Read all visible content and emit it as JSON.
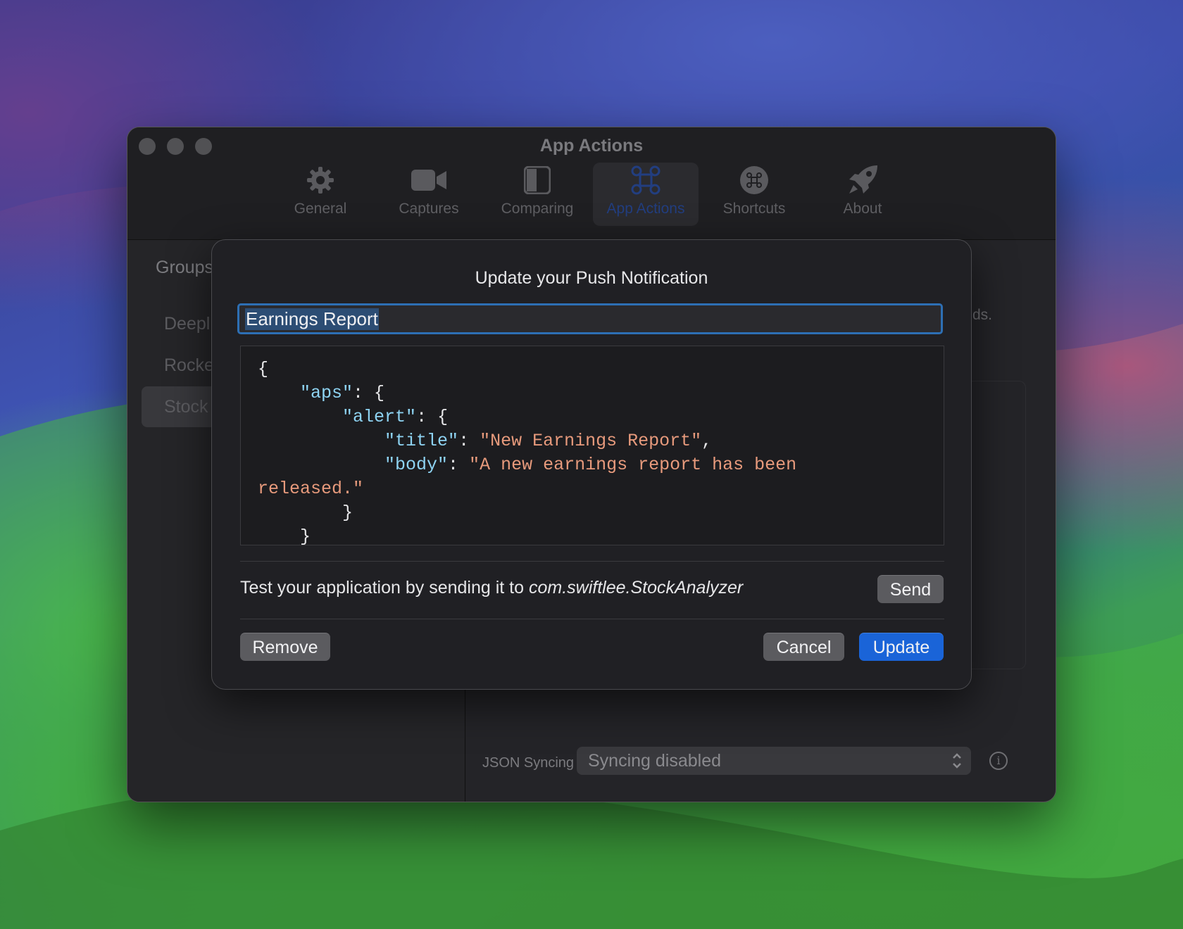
{
  "window": {
    "title": "App Actions"
  },
  "toolbar": {
    "items": [
      {
        "label": "General",
        "icon": "gear-icon",
        "active": false
      },
      {
        "label": "Captures",
        "icon": "video-camera-icon",
        "active": false
      },
      {
        "label": "Comparing",
        "icon": "split-view-icon",
        "active": false
      },
      {
        "label": "App Actions",
        "icon": "command-icon",
        "active": true
      },
      {
        "label": "Shortcuts",
        "icon": "command-circle-icon",
        "active": false
      },
      {
        "label": "About",
        "icon": "rocket-icon",
        "active": false
      }
    ]
  },
  "sidebar": {
    "heading": "Groups",
    "items": [
      {
        "label": "Deepl"
      },
      {
        "label": "Rocke"
      },
      {
        "label": "Stock",
        "selected": true
      }
    ]
  },
  "background_partial": {
    "text": "ds."
  },
  "footer": {
    "json_label": "JSON Syncing",
    "json_select_value": "Syncing disabled"
  },
  "sheet": {
    "title": "Update your Push Notification",
    "name_value": "Earnings Report",
    "payload": {
      "key_aps": "\"aps\"",
      "key_alert": "\"alert\"",
      "key_title": "\"title\"",
      "value_title": "\"New Earnings Report\"",
      "key_body": "\"body\"",
      "value_body_1": "\"A new earnings report has been",
      "value_body_2": "released.\""
    },
    "test_prefix": "Test your application by sending it to ",
    "bundle_id": "com.swiftlee.StockAnalyzer",
    "send_label": "Send",
    "remove_label": "Remove",
    "cancel_label": "Cancel",
    "update_label": "Update"
  },
  "colors": {
    "accent": "#1a64d8",
    "focus_ring": "#2d6fb4",
    "json_key": "#8ed3f2",
    "json_string": "#e79a7c"
  }
}
